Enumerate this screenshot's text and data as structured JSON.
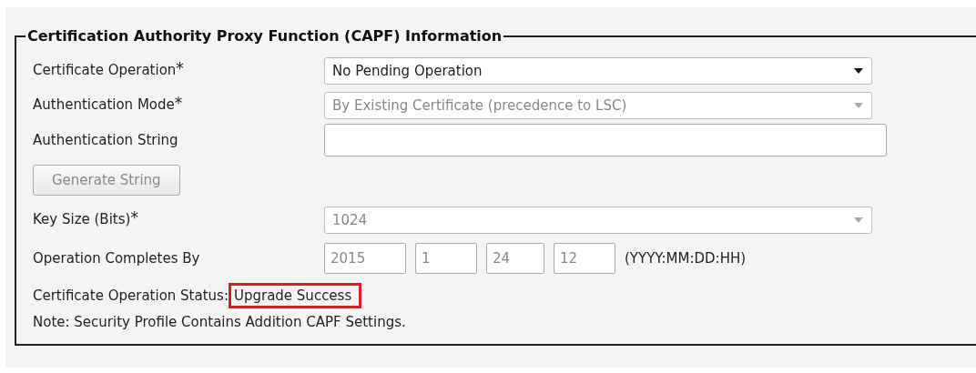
{
  "section": {
    "title": "Certification Authority Proxy Function (CAPF) Information"
  },
  "rows": [
    {
      "kind": "select",
      "label": "Certificate Operation",
      "mark": "*",
      "value": "No Pending Operation",
      "disabled": false
    },
    {
      "kind": "select",
      "label": "Authentication Mode",
      "mark": "*",
      "value": "By Existing Certificate (precedence to LSC)",
      "disabled": true
    },
    {
      "kind": "text",
      "label": "Authentication String"
    },
    {
      "kind": "button",
      "label": "Generate String",
      "disabled": true
    },
    {
      "kind": "select",
      "label": "Key Size (Bits)",
      "mark": "*",
      "value": "1024",
      "disabled": true
    },
    {
      "kind": "date",
      "label": "Operation Completes By",
      "parts": [
        "2015",
        "1",
        "24",
        "12"
      ],
      "format": "(YYYY:MM:DD:HH)",
      "disabled": true
    }
  ],
  "status": {
    "label": "Certificate Operation Status:",
    "value": "Upgrade Success",
    "highlighted": true
  },
  "note": "Note: Security Profile Contains Addition CAPF Settings."
}
